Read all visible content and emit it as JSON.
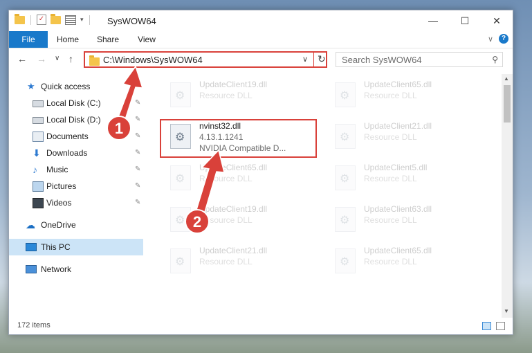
{
  "window": {
    "title": "SysWOW64",
    "controls": {
      "minimize": "—",
      "maximize": "☐",
      "close": "✕"
    }
  },
  "ribbon": {
    "tabs": [
      "File",
      "Home",
      "Share",
      "View"
    ],
    "expand_glyph": "∨",
    "help_glyph": "?"
  },
  "nav": {
    "back": "←",
    "forward": "→",
    "recent": "∨",
    "up": "↑",
    "address": "C:\\Windows\\SysWOW64",
    "address_dropdown": "∨",
    "refresh": "↻",
    "search_placeholder": "Search SysWOW64",
    "search_icon": "⚲"
  },
  "sidebar": {
    "items": [
      {
        "label": "Quick access",
        "icon": "star-icon",
        "pinned": false
      },
      {
        "label": "Local Disk (C:)",
        "icon": "drive-icon",
        "pinned": true
      },
      {
        "label": "Local Disk (D:)",
        "icon": "drive-icon",
        "pinned": true
      },
      {
        "label": "Documents",
        "icon": "documents-icon",
        "pinned": true
      },
      {
        "label": "Downloads",
        "icon": "downloads-icon",
        "pinned": true
      },
      {
        "label": "Music",
        "icon": "music-icon",
        "pinned": true
      },
      {
        "label": "Pictures",
        "icon": "pictures-icon",
        "pinned": true
      },
      {
        "label": "Videos",
        "icon": "videos-icon",
        "pinned": true
      },
      {
        "label": "OneDrive",
        "icon": "cloud-icon",
        "pinned": false
      },
      {
        "label": "This PC",
        "icon": "computer-icon",
        "pinned": false,
        "selected": true
      },
      {
        "label": "Network",
        "icon": "network-icon",
        "pinned": false
      }
    ],
    "pin_glyph": "📌"
  },
  "files": {
    "left_column": [
      {
        "name": "UpdateClient19.dll",
        "line2": "Resource DLL",
        "faded": true
      },
      {
        "name": "nvinst32.dll",
        "line2": "4.13.1.1241",
        "line3": "NVIDIA Compatible D...",
        "faded": false
      },
      {
        "name": "UpdateClient65.dll",
        "line2": "Resource DLL",
        "faded": true
      },
      {
        "name": "UpdateClient19.dll",
        "line2": "Resource DLL",
        "faded": true
      },
      {
        "name": "UpdateClient21.dll",
        "line2": "Resource DLL",
        "faded": true
      }
    ],
    "right_column": [
      {
        "name": "UpdateClient65.dll",
        "line2": "Resource DLL"
      },
      {
        "name": "UpdateClient21.dll",
        "line2": "Resource DLL"
      },
      {
        "name": "UpdateClient5.dll",
        "line2": "Resource DLL"
      },
      {
        "name": "UpdateClient63.dll",
        "line2": "Resource DLL"
      },
      {
        "name": "UpdateClient65.dll",
        "line2": "Resource DLL"
      }
    ]
  },
  "status": {
    "item_count": "172 items"
  },
  "annotations": {
    "step1": "1",
    "step2": "2",
    "color": "#d9413a"
  },
  "colors": {
    "accent": "#1979ca",
    "selection": "#cce4f7",
    "highlight": "#d9413a"
  }
}
